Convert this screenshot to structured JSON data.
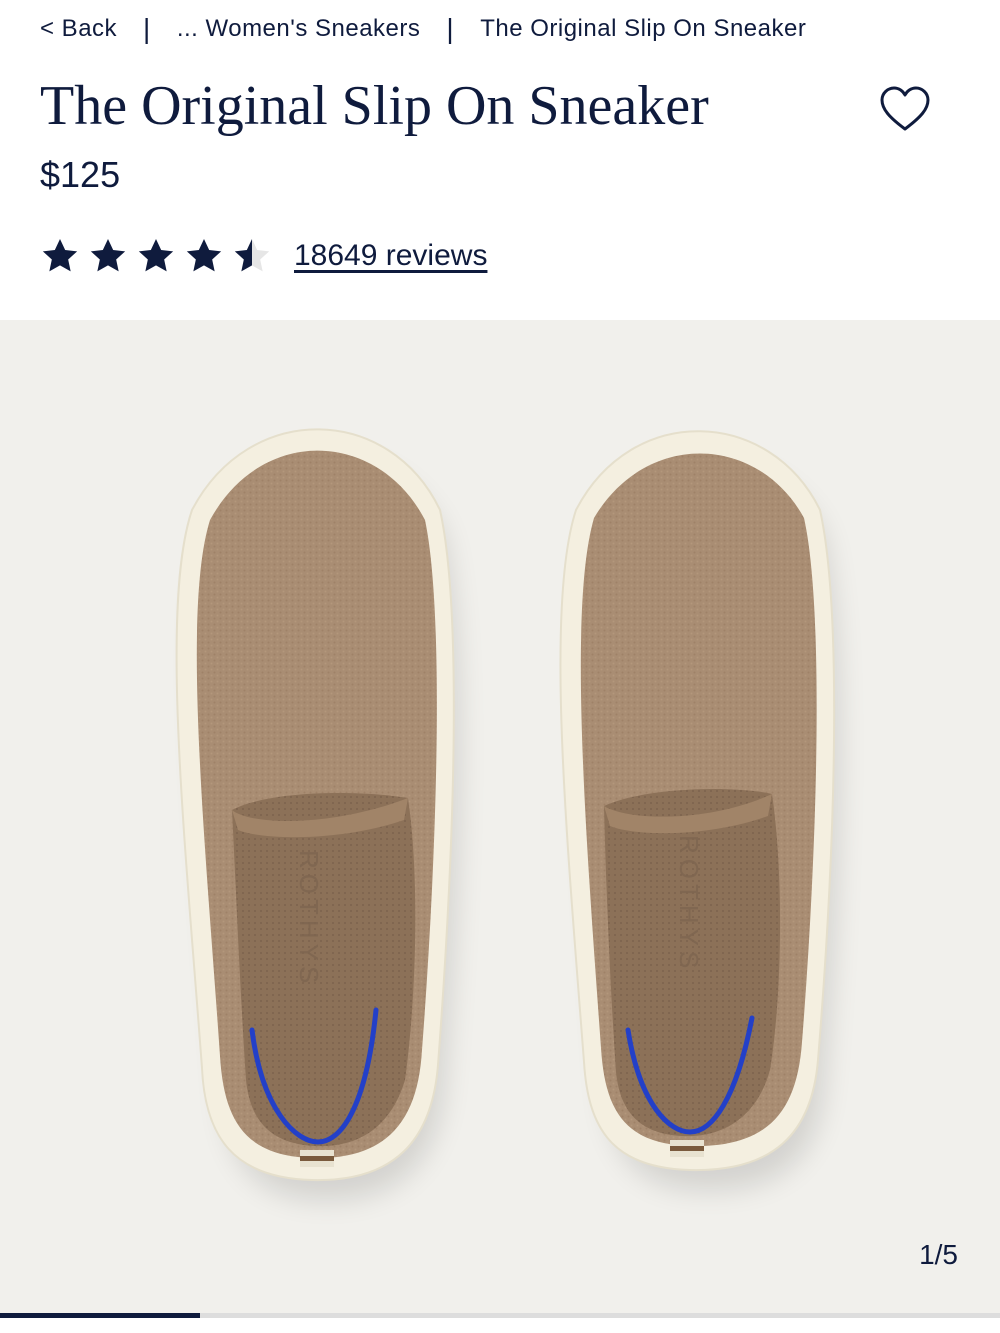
{
  "breadcrumb": {
    "back": "< Back",
    "separator": "|",
    "category": "... Women's Sneakers",
    "current": "The Original Slip On Sneaker"
  },
  "product": {
    "title": "The Original Slip On Sneaker",
    "price": "$125",
    "rating": 4.5,
    "reviews_label": "18649 reviews",
    "favorite_icon": "heart-outline-icon"
  },
  "gallery": {
    "counter": "1/5",
    "progress": 0.2,
    "insole_brand": "ROTHYS",
    "image_icon": "slip-on-sneaker-pair-image"
  },
  "colors": {
    "navy": "#0f1b3d",
    "gallery_bg": "#f1f0ec",
    "shoe_knit": "#a98d73",
    "sole": "#f4efe0",
    "heel_accent": "#2340c8"
  }
}
